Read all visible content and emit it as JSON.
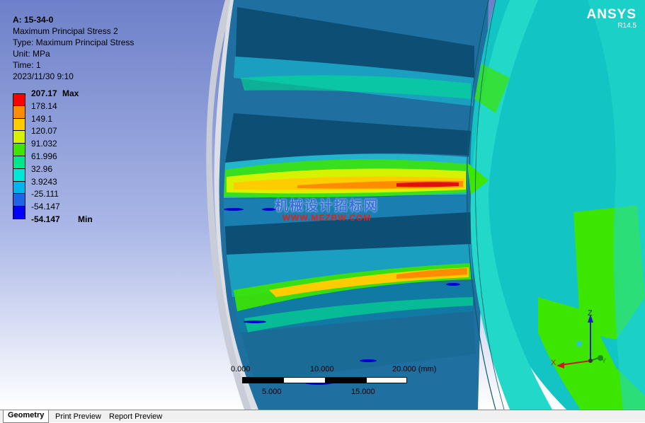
{
  "result": {
    "name": "A: 15-34-0",
    "subtitle": "Maximum Principal Stress 2",
    "type": "Type: Maximum Principal Stress",
    "unit": "Unit: MPa",
    "time": "Time: 1",
    "date": "2023/11/30 9:10"
  },
  "legend": {
    "max_value": "207.17",
    "max_suffix": "Max",
    "min_value": "-54.147",
    "min_suffix": "Min",
    "levels": [
      "207.17",
      "178.14",
      "149.1",
      "120.07",
      "91.032",
      "61.996",
      "32.96",
      "3.9243",
      "-25.111",
      "-54.147"
    ],
    "colors": [
      "#ff0000",
      "#ff8c00",
      "#ffcc00",
      "#d7f200",
      "#3ce600",
      "#00e68c",
      "#00e6d7",
      "#00b4f0",
      "#1f64e6",
      "#0000ff"
    ]
  },
  "brand": {
    "name": "ANSYS",
    "version": "R14.5"
  },
  "watermark": {
    "text": "机械设计招标网",
    "url": "WWW.MEZBW.COM"
  },
  "scale_bar": {
    "top_labels": [
      "0.000",
      "10.000",
      "20.000 (mm)"
    ],
    "bottom_labels": [
      "5.000",
      "15.000"
    ]
  },
  "triad": {
    "z_label": "Z",
    "x_label": "X",
    "y_label": "Y"
  },
  "tabs": [
    {
      "label": "Geometry",
      "active": true
    },
    {
      "label": "Print Preview",
      "active": false
    },
    {
      "label": "Report Preview",
      "active": false
    }
  ]
}
